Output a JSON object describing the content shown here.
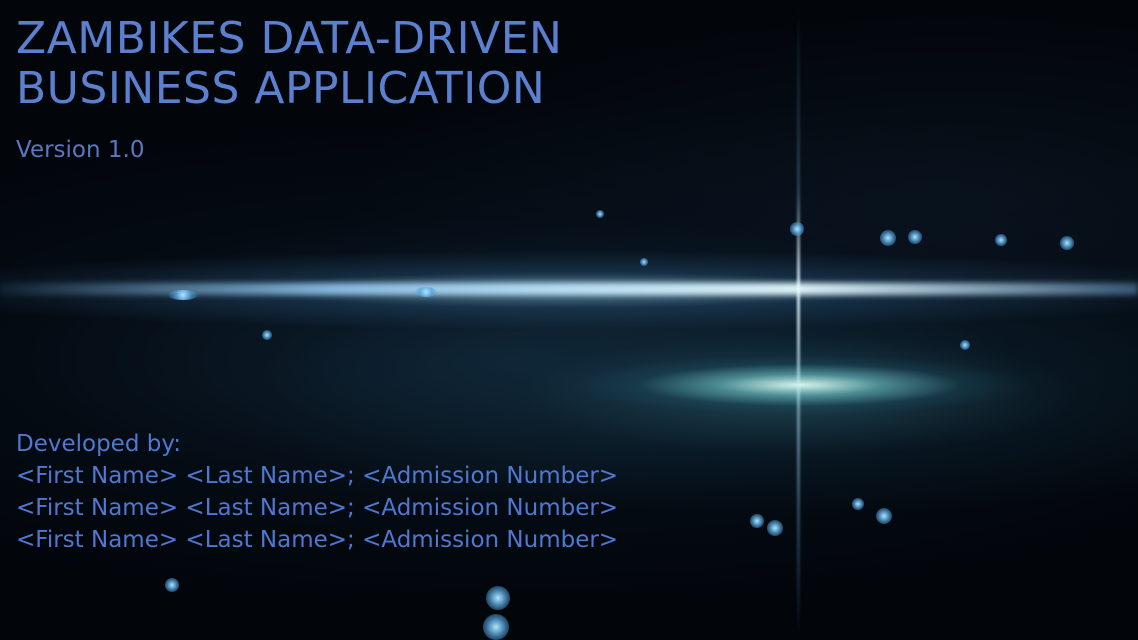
{
  "app": {
    "title_line_1": "ZAMBIKES DATA-DRIVEN",
    "title_line_2": "BUSINESS APPLICATION",
    "version": "Version 1.0"
  },
  "credits": {
    "heading": "Developed by:",
    "developers": [
      "<First Name> <Last Name>; <Admission Number>",
      "<First Name> <Last Name>; <Admission Number>",
      "<First Name> <Last Name>; <Admission Number>"
    ]
  },
  "colors": {
    "text_accent": "#5b80d0",
    "background": "#02050a"
  }
}
